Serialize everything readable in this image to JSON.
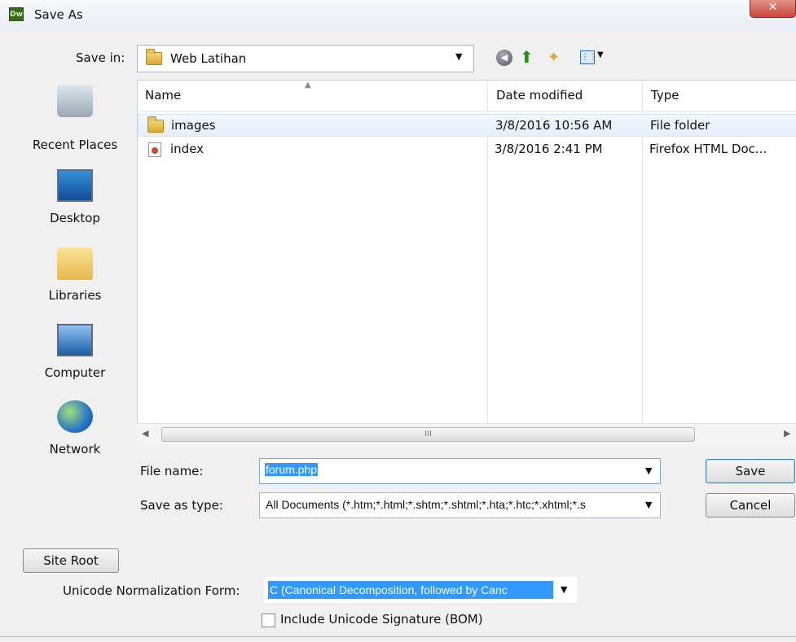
{
  "window": {
    "app_icon_text": "Dw",
    "title": "Save As",
    "close_glyph": "✕"
  },
  "save_in": {
    "label": "Save in:",
    "value": "Web Latihan",
    "arrow": "▼"
  },
  "toolbar": {
    "back_glyph": "◀",
    "up_glyph": "⬆",
    "new_folder_glyph": "✦",
    "views_glyph": "⋮⋮",
    "views_arrow": "▼"
  },
  "places": [
    {
      "label": "Recent Places",
      "icon": "recent-places-icon"
    },
    {
      "label": "Desktop",
      "icon": "desktop-icon"
    },
    {
      "label": "Libraries",
      "icon": "libraries-icon"
    },
    {
      "label": "Computer",
      "icon": "computer-icon"
    },
    {
      "label": "Network",
      "icon": "network-icon"
    }
  ],
  "file_list": {
    "columns": [
      "Name",
      "Date modified",
      "Type"
    ],
    "sort_glyph": "▲",
    "rows": [
      {
        "name": "images",
        "date": "3/8/2016 10:56 AM",
        "type": "File folder",
        "icon": "folder-icon"
      },
      {
        "name": "index",
        "date": "3/8/2016 2:41 PM",
        "type": "Firefox HTML Doc...",
        "icon": "firefox-html-icon"
      }
    ]
  },
  "scrollbar": {
    "left_glyph": "◀",
    "right_glyph": "▶",
    "grip": "III"
  },
  "form": {
    "file_name_label": "File name:",
    "file_name_value": "forum.php",
    "save_type_label": "Save as type:",
    "save_type_value": "All Documents (*.htm;*.html;*.shtm;*.shtml;*.hta;*.htc;*.xhtml;*.s",
    "dropdown_arrow": "▼"
  },
  "buttons": {
    "save": "Save",
    "cancel": "Cancel",
    "site_root": "Site Root"
  },
  "unicode": {
    "label": "Unicode Normalization Form:",
    "value": "C (Canonical Decomposition, followed by Canc",
    "bom_label": "Include Unicode Signature (BOM)",
    "bom_checked": false
  },
  "colors": {
    "selection": "#3399ff",
    "close_button": "#c9443a"
  }
}
